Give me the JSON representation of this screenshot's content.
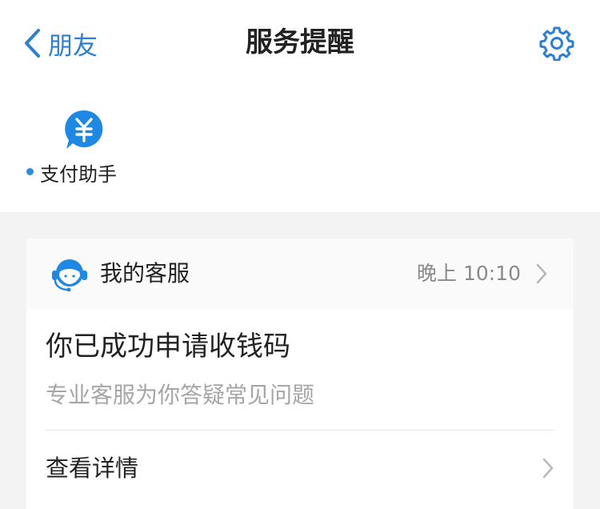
{
  "nav": {
    "back_label": "朋友",
    "title": "服务提醒"
  },
  "shortcuts": [
    {
      "label": "支付助手",
      "icon": "yuan-icon",
      "unread": true
    }
  ],
  "card": {
    "sender": "我的客服",
    "time": "晚上 10:10",
    "message_title": "你已成功申请收钱码",
    "message_subtitle": "专业客服为你答疑常见问题",
    "detail_label": "查看详情"
  },
  "colors": {
    "accent": "#2b7fd6",
    "unread_dot": "#2d8ce0",
    "text_primary": "#222222",
    "text_secondary": "#a6a6a6",
    "background": "#f3f3f3"
  }
}
